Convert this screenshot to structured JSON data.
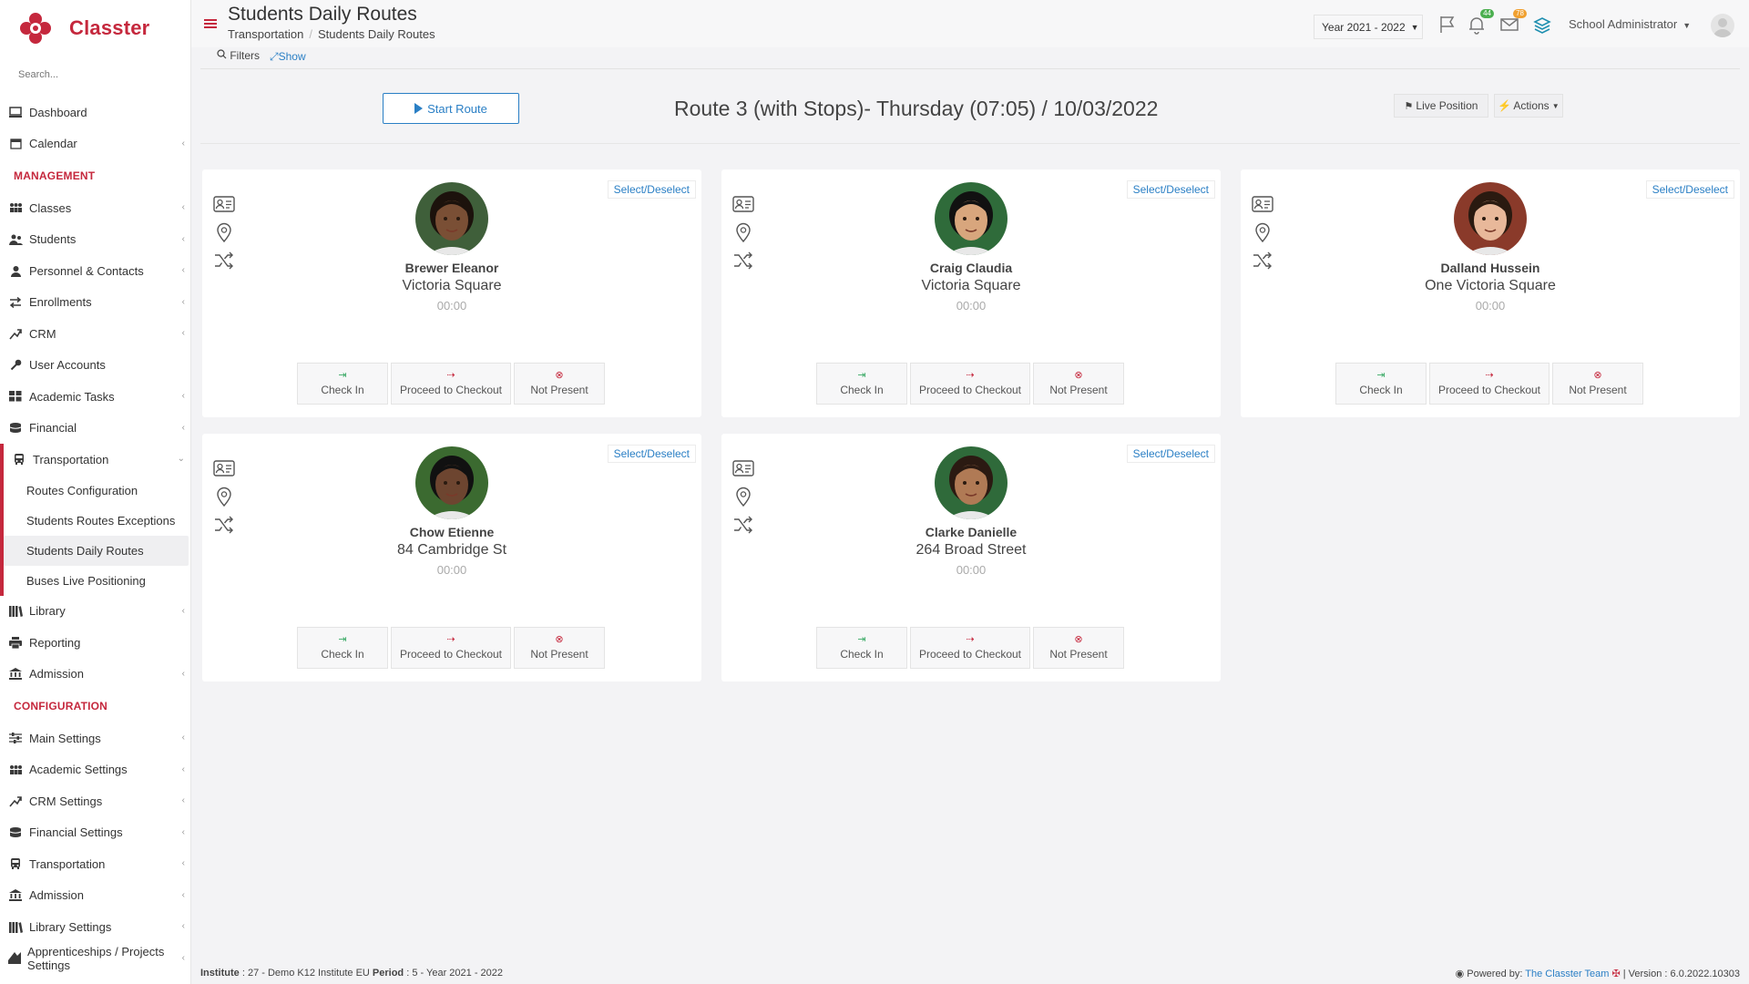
{
  "app": {
    "name": "Classter"
  },
  "sidebar": {
    "search_placeholder": "Search...",
    "items_top": [
      {
        "label": "Dashboard",
        "icon": "monitor-icon",
        "chev": false
      },
      {
        "label": "Calendar",
        "icon": "calendar-icon",
        "chev": true
      }
    ],
    "management_title": "MANAGEMENT",
    "items_mgmt": [
      {
        "label": "Classes",
        "icon": "classes-icon",
        "chev": true
      },
      {
        "label": "Students",
        "icon": "students-icon",
        "chev": true
      },
      {
        "label": "Personnel & Contacts",
        "icon": "personnel-icon",
        "chev": true
      },
      {
        "label": "Enrollments",
        "icon": "enrollments-icon",
        "chev": true
      },
      {
        "label": "CRM",
        "icon": "crm-icon",
        "chev": true
      },
      {
        "label": "User Accounts",
        "icon": "key-icon",
        "chev": false
      },
      {
        "label": "Academic Tasks",
        "icon": "tasks-icon",
        "chev": true
      },
      {
        "label": "Financial",
        "icon": "money-icon",
        "chev": true
      }
    ],
    "transport": {
      "label": "Transportation",
      "subitems": [
        {
          "label": "Routes Configuration",
          "active": false
        },
        {
          "label": "Students Routes Exceptions",
          "active": false
        },
        {
          "label": "Students Daily Routes",
          "active": true
        },
        {
          "label": "Buses Live Positioning",
          "active": false
        }
      ]
    },
    "items_after": [
      {
        "label": "Library",
        "icon": "library-icon",
        "chev": true
      },
      {
        "label": "Reporting",
        "icon": "print-icon",
        "chev": false
      },
      {
        "label": "Admission",
        "icon": "bank-icon",
        "chev": true
      }
    ],
    "configuration_title": "CONFIGURATION",
    "items_config": [
      {
        "label": "Main Settings",
        "icon": "sliders-icon",
        "chev": true
      },
      {
        "label": "Academic Settings",
        "icon": "classes-icon",
        "chev": true
      },
      {
        "label": "CRM Settings",
        "icon": "crm-icon",
        "chev": true
      },
      {
        "label": "Financial Settings",
        "icon": "money-icon",
        "chev": true
      },
      {
        "label": "Transportation",
        "icon": "bus-icon",
        "chev": true
      },
      {
        "label": "Admission",
        "icon": "bank-icon",
        "chev": true
      },
      {
        "label": "Library Settings",
        "icon": "library-icon",
        "chev": true
      },
      {
        "label": "Apprenticeships / Projects Settings",
        "icon": "projects-icon",
        "chev": true
      }
    ]
  },
  "header": {
    "title": "Students Daily Routes",
    "breadcrumb": [
      "Transportation",
      "Students Daily Routes"
    ],
    "year": "Year 2021 - 2022",
    "notifications_count": "44",
    "messages_count": "78",
    "user": "School Administrator"
  },
  "filters": {
    "label": "Filters",
    "show": "Show"
  },
  "route": {
    "start_label": "Start Route",
    "title": "Route 3 (with Stops)- Thursday (07:05) / 10/03/2022",
    "live_label": "Live Position",
    "actions_label": "Actions"
  },
  "card_labels": {
    "select": "Select/Deselect",
    "check_in": "Check In",
    "checkout": "Proceed to Checkout",
    "not_present": "Not Present"
  },
  "students": [
    {
      "name": "Brewer Eleanor",
      "address": "Victoria Square",
      "time": "00:00"
    },
    {
      "name": "Craig Claudia",
      "address": "Victoria Square",
      "time": "00:00"
    },
    {
      "name": "Dalland Hussein",
      "address": "One Victoria Square",
      "time": "00:00"
    },
    {
      "name": "Chow Etienne",
      "address": "84 Cambridge St",
      "time": "00:00"
    },
    {
      "name": "Clarke Danielle",
      "address": "264 Broad Street",
      "time": "00:00"
    }
  ],
  "footer": {
    "institute_label": "Institute",
    "institute_value": ": 27 - Demo K12 Institute EU",
    "period_label": "Period",
    "period_value": ": 5 - Year 2021 - 2022",
    "powered_by": "Powered by:",
    "team": "The Classter Team",
    "version": "| Version : 6.0.2022.10303"
  },
  "colors": {
    "brand": "#c5283d",
    "link": "#2a7fc5"
  }
}
